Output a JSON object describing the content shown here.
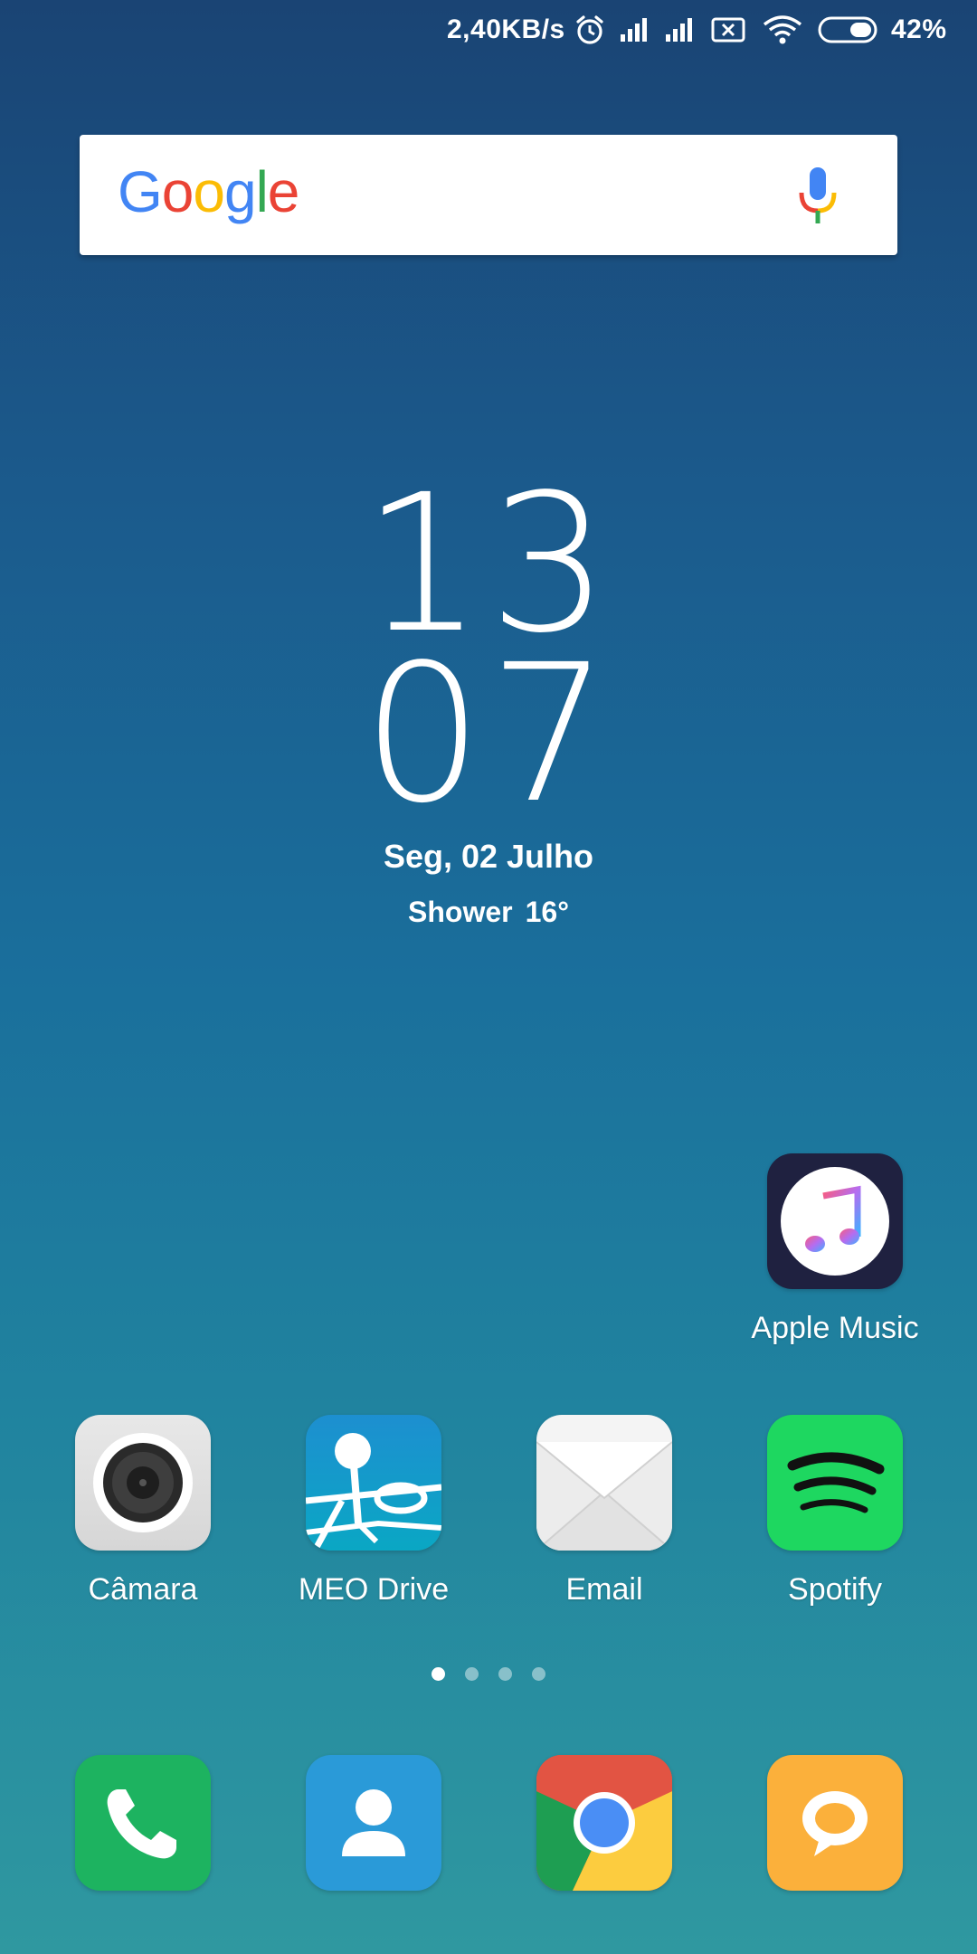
{
  "status_bar": {
    "network_speed": "2,40KB/s",
    "battery_percent": "42%",
    "battery_level": 0.42,
    "icons": [
      "alarm-icon",
      "signal-icon",
      "signal-icon",
      "sim-no-service-icon",
      "wifi-icon",
      "battery-icon"
    ]
  },
  "search": {
    "brand": [
      "G",
      "o",
      "o",
      "g",
      "l",
      "e"
    ],
    "brand_colors": [
      "#4285F4",
      "#EA4335",
      "#FBBC05",
      "#4285F4",
      "#34A853",
      "#EA4335"
    ],
    "mic_icon": "microphone-icon"
  },
  "clock": {
    "hours": "13",
    "minutes": "07"
  },
  "date": "Seg, 02 Julho",
  "weather": {
    "condition": "Shower",
    "temperature": "16°"
  },
  "apps": {
    "apple_music": {
      "label": "Apple Music",
      "icon": "apple-music-icon"
    },
    "row": [
      {
        "label": "Câmara",
        "icon": "camera-icon"
      },
      {
        "label": "MEO Drive",
        "icon": "meo-drive-icon"
      },
      {
        "label": "Email",
        "icon": "email-icon"
      },
      {
        "label": "Spotify",
        "icon": "spotify-icon"
      }
    ]
  },
  "page_indicator": {
    "count": 4,
    "active": 1
  },
  "dock": [
    {
      "icon": "phone-icon",
      "color": "#1db360"
    },
    {
      "icon": "contacts-icon",
      "color": "#2a9ad8"
    },
    {
      "icon": "chrome-icon",
      "color": "#e25443"
    },
    {
      "icon": "messages-icon",
      "color": "#fbb03b"
    }
  ]
}
